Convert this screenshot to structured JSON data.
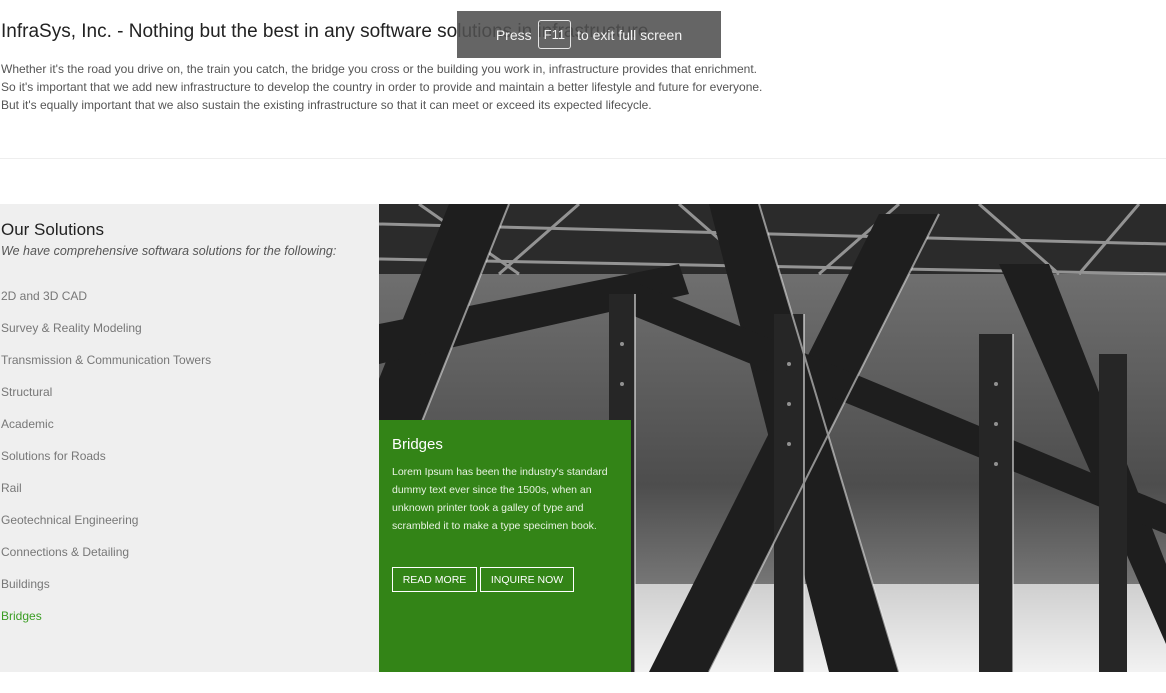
{
  "intro": {
    "title": "InfraSys, Inc. - Nothing but the best in any software solutions in infrastructure",
    "lines": [
      "Whether it's the road you drive on, the train you catch, the bridge you cross or the building you work in, infrastructure provides that enrichment.",
      "So it's important that we add new infrastructure to develop the country in order to provide and maintain a better lifestyle and future for everyone.",
      "But it's equally important that we also sustain the existing infrastructure so that it can meet or exceed its expected lifecycle."
    ]
  },
  "fullscreen_toast": {
    "press": "Press",
    "key": "F11",
    "message": "to exit full screen"
  },
  "solutions": {
    "heading": "Our Solutions",
    "subheading": "We have comprehensive softwara solutions for the following:",
    "items": [
      "2D and 3D CAD",
      "Survey & Reality Modeling",
      "Transmission & Communication Towers",
      "Structural",
      "Academic",
      "Solutions for Roads",
      "Rail",
      "Geotechnical Engineering",
      "Connections & Detailing",
      "Buildings",
      "Bridges"
    ],
    "active_index": 10
  },
  "feature": {
    "title": "Bridges",
    "description": "Lorem Ipsum has been the industry's standard dummy text ever since the 1500s, when an unknown printer took a galley of type and scrambled it to make a type specimen book.",
    "read_more": "READ MORE",
    "inquire": "INQUIRE NOW",
    "accent_color": "#338417",
    "active_link_color": "#3a9d23"
  },
  "hero_image": {
    "icon": "steel-bridge-photo"
  }
}
